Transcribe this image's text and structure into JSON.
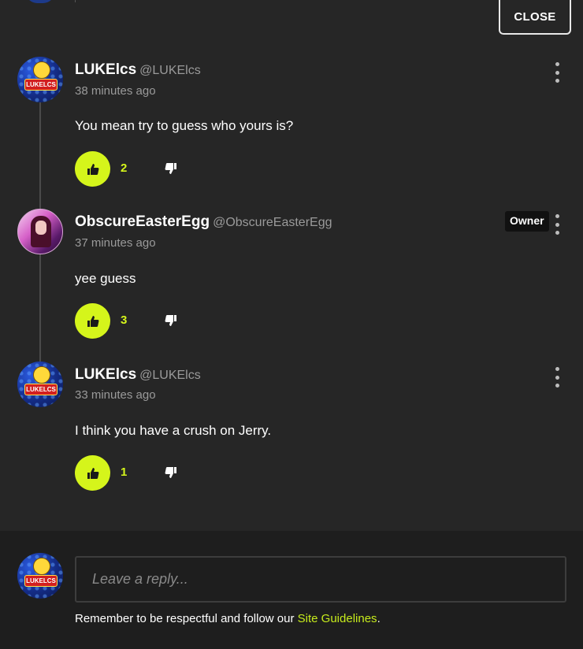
{
  "close_button": {
    "label": "CLOSE"
  },
  "comments": [
    {
      "username": "LUKElcs",
      "handle": "@LUKElcs",
      "time": "38 minutes ago",
      "text": "You mean try to guess who yours is?",
      "likes": "2",
      "avatar_text": "LUKELCS",
      "badge": ""
    },
    {
      "username": "ObscureEasterEgg",
      "handle": "@ObscureEasterEgg",
      "time": "37 minutes ago",
      "text": "yee guess",
      "likes": "3",
      "badge": "Owner"
    },
    {
      "username": "LUKElcs",
      "handle": "@LUKElcs",
      "time": "33 minutes ago",
      "text": "I think you have a crush on Jerry.",
      "likes": "1",
      "avatar_text": "LUKELCS",
      "badge": ""
    }
  ],
  "reply": {
    "placeholder": "Leave a reply...",
    "avatar_text": "LUKELCS",
    "guidelines_prefix": "Remember to be respectful and follow our ",
    "guidelines_link": "Site Guidelines",
    "guidelines_suffix": "."
  },
  "colors": {
    "background": "#262626",
    "footer_background": "#1e1e1e",
    "accent": "#d5f51b",
    "muted_text": "#9a9a9a"
  },
  "icons": {
    "like": "thumbs-up-icon",
    "dislike": "thumbs-down-icon",
    "more": "kebab-menu-icon"
  }
}
